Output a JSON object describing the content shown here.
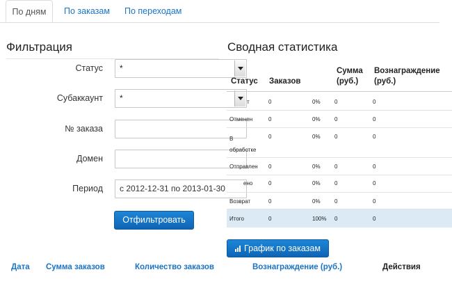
{
  "tabs": [
    {
      "label": "По дням"
    },
    {
      "label": "По заказам"
    },
    {
      "label": "По переходам"
    }
  ],
  "filter": {
    "title": "Фильтрация",
    "status_label": "Статус",
    "status_value": "*",
    "subaccount_label": "Субаккаунт",
    "subaccount_value": "*",
    "order_label": "№ заказа",
    "order_value": "",
    "domain_label": "Домен",
    "domain_value": "",
    "period_label": "Период",
    "period_value": "с 2012-12-31 по 2013-01-30",
    "submit_label": "Отфильтровать"
  },
  "stats": {
    "title": "Сводная статистика",
    "headers": {
      "status": "Статус",
      "orders": "Заказов",
      "sum_line1": "Сумма",
      "sum_line2": "(руб.)",
      "reward_line1": "Вознаграждение",
      "reward_line2": "(руб.)"
    },
    "rows": [
      {
        "status": "т",
        "orders": "0",
        "percent": "0%",
        "sum": "0",
        "reward": "0"
      },
      {
        "status": "Отменен",
        "orders": "0",
        "percent": "0%",
        "sum": "0",
        "reward": "0"
      },
      {
        "status_line1": "В",
        "status_line2": "обработке",
        "orders": "0",
        "percent": "0%",
        "sum": "0",
        "reward": "0"
      },
      {
        "status": "Отправлен",
        "orders": "0",
        "percent": "0%",
        "sum": "0",
        "reward": "0"
      },
      {
        "status": "ено",
        "orders": "0",
        "percent": "0%",
        "sum": "0",
        "reward": "0"
      },
      {
        "status": "Возврат",
        "orders": "0",
        "percent": "0%",
        "sum": "0",
        "reward": "0"
      }
    ],
    "total": {
      "status": "Итого",
      "orders": "0",
      "percent": "100%",
      "sum": "0",
      "reward": "0"
    },
    "chart_button": "График по заказам"
  },
  "bottom_table": {
    "headers": [
      "Дата",
      "Сумма заказов",
      "Количество заказов",
      "Вознаграждение (руб.)",
      "Действия"
    ]
  },
  "colors": {
    "link": "#1a74c6",
    "primary": "#1570c4",
    "total_row": "#dceaf6"
  }
}
